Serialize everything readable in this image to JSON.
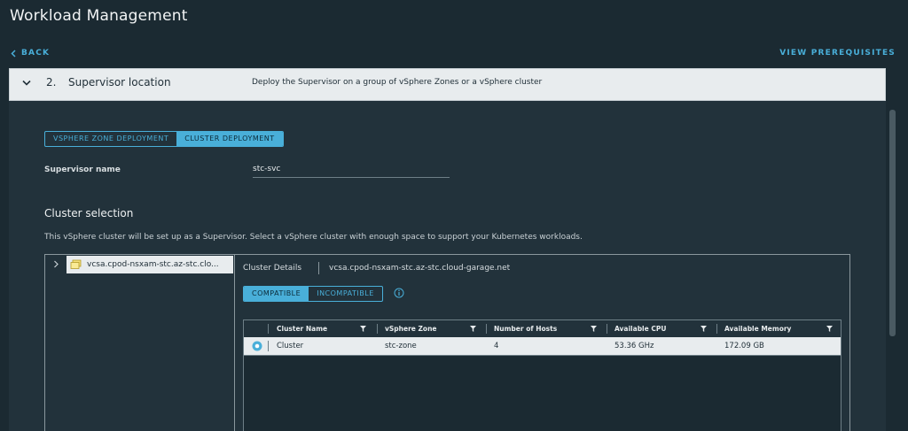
{
  "header": {
    "title": "Workload Management",
    "back_label": "BACK",
    "prerequisites_label": "VIEW PREREQUISITES"
  },
  "step": {
    "number": "2.",
    "title": "Supervisor location",
    "description": "Deploy the Supervisor on a group of vSphere Zones or a vSphere cluster"
  },
  "deployment_toggle": {
    "options": [
      "VSPHERE ZONE DEPLOYMENT",
      "CLUSTER DEPLOYMENT"
    ],
    "selected": "CLUSTER DEPLOYMENT"
  },
  "supervisor": {
    "label": "Supervisor name",
    "value": "stc-svc"
  },
  "cluster_selection": {
    "heading": "Cluster selection",
    "description": "This vSphere cluster will be set up as a Supervisor. Select a vSphere cluster with enough space to support your Kubernetes workloads.",
    "tree_node": "vcsa.cpod-nsxam-stc.az-stc.clo...",
    "details_label": "Cluster Details",
    "details_value": "vcsa.cpod-nsxam-stc.az-stc.cloud-garage.net",
    "compat_options": [
      "COMPATIBLE",
      "INCOMPATIBLE"
    ],
    "compat_selected": "COMPATIBLE"
  },
  "grid": {
    "columns": [
      "Cluster Name",
      "vSphere Zone",
      "Number of Hosts",
      "Available CPU",
      "Available Memory"
    ],
    "rows": [
      {
        "name": "Cluster",
        "zone": "stc-zone",
        "hosts": "4",
        "cpu": "53.36 GHz",
        "memory": "172.09 GB",
        "selected": true
      }
    ]
  },
  "colors": {
    "background": "#1b2a32",
    "panel": "#22323b",
    "accent": "#49afd9",
    "light_row": "#e8ecee"
  },
  "icons": [
    "chevron-left-icon",
    "chevron-down-icon",
    "chevron-right-icon",
    "cluster-icon",
    "info-icon",
    "filter-icon",
    "radio-selected-icon"
  ]
}
